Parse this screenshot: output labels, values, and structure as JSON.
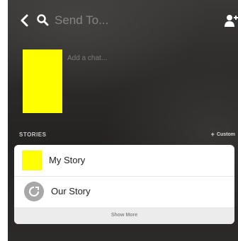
{
  "search": {
    "placeholder": "Send To..."
  },
  "chat": {
    "placeholder": "Add a chat..."
  },
  "stories": {
    "title": "STORIES",
    "custom_label": "Custom",
    "items": [
      {
        "label": "My Story"
      },
      {
        "label": "Our Story"
      }
    ],
    "show_more_label": "Show More"
  },
  "colors": {
    "thumb_yellow": "#ffff00"
  },
  "icons": [
    "back-icon",
    "search-icon",
    "add-friend-icon",
    "plus-icon",
    "our-story-icon"
  ]
}
